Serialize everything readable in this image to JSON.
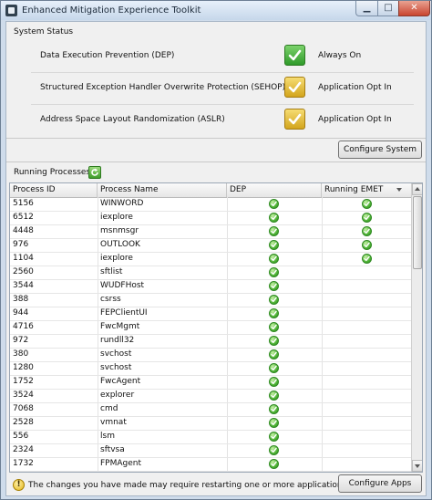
{
  "window": {
    "title": "Enhanced Mitigation Experience Toolkit",
    "minimize_glyph": "▁",
    "maximize_glyph": "□",
    "close_glyph": "✕"
  },
  "system_status": {
    "label": "System Status",
    "rows": [
      {
        "name": "Data Execution Prevention (DEP)",
        "value": "Always On",
        "icon": "green-check-icon"
      },
      {
        "name": "Structured Exception Handler Overwrite Protection (SEHOP)",
        "value": "Application Opt In",
        "icon": "yellow-check-icon"
      },
      {
        "name": "Address Space Layout Randomization (ASLR)",
        "value": "Application Opt In",
        "icon": "yellow-check-icon"
      }
    ],
    "configure_button": "Configure System"
  },
  "running_processes": {
    "label": "Running Processes",
    "refresh_icon": "refresh-icon",
    "columns": [
      "Process ID",
      "Process Name",
      "DEP",
      "Running EMET"
    ],
    "rows": [
      {
        "pid": "5156",
        "name": "WINWORD",
        "dep": true,
        "emet": true
      },
      {
        "pid": "6512",
        "name": "iexplore",
        "dep": true,
        "emet": true
      },
      {
        "pid": "4448",
        "name": "msnmsgr",
        "dep": true,
        "emet": true
      },
      {
        "pid": "976",
        "name": "OUTLOOK",
        "dep": true,
        "emet": true
      },
      {
        "pid": "1104",
        "name": "iexplore",
        "dep": true,
        "emet": true
      },
      {
        "pid": "2560",
        "name": "sftlist",
        "dep": true,
        "emet": false
      },
      {
        "pid": "3544",
        "name": "WUDFHost",
        "dep": true,
        "emet": false
      },
      {
        "pid": "388",
        "name": "csrss",
        "dep": true,
        "emet": false
      },
      {
        "pid": "944",
        "name": "FEPClientUI",
        "dep": true,
        "emet": false
      },
      {
        "pid": "4716",
        "name": "FwcMgmt",
        "dep": true,
        "emet": false
      },
      {
        "pid": "972",
        "name": "rundll32",
        "dep": true,
        "emet": false
      },
      {
        "pid": "380",
        "name": "svchost",
        "dep": true,
        "emet": false
      },
      {
        "pid": "1280",
        "name": "svchost",
        "dep": true,
        "emet": false
      },
      {
        "pid": "1752",
        "name": "FwcAgent",
        "dep": true,
        "emet": false
      },
      {
        "pid": "3524",
        "name": "explorer",
        "dep": true,
        "emet": false
      },
      {
        "pid": "7068",
        "name": "cmd",
        "dep": true,
        "emet": false
      },
      {
        "pid": "2528",
        "name": "vmnat",
        "dep": true,
        "emet": false
      },
      {
        "pid": "556",
        "name": "lsm",
        "dep": true,
        "emet": false
      },
      {
        "pid": "2324",
        "name": "sftvsa",
        "dep": true,
        "emet": false
      },
      {
        "pid": "1732",
        "name": "FPMAgent",
        "dep": true,
        "emet": false
      }
    ]
  },
  "footer": {
    "warning_icon": "warning-icon",
    "warning_glyph": "!",
    "message": "The changes you have made may require restarting one or more applications",
    "configure_button": "Configure Apps"
  },
  "colors": {
    "check_green": "#3aa52c",
    "check_yellow": "#d9ab1f",
    "close_red": "#c9452f"
  }
}
